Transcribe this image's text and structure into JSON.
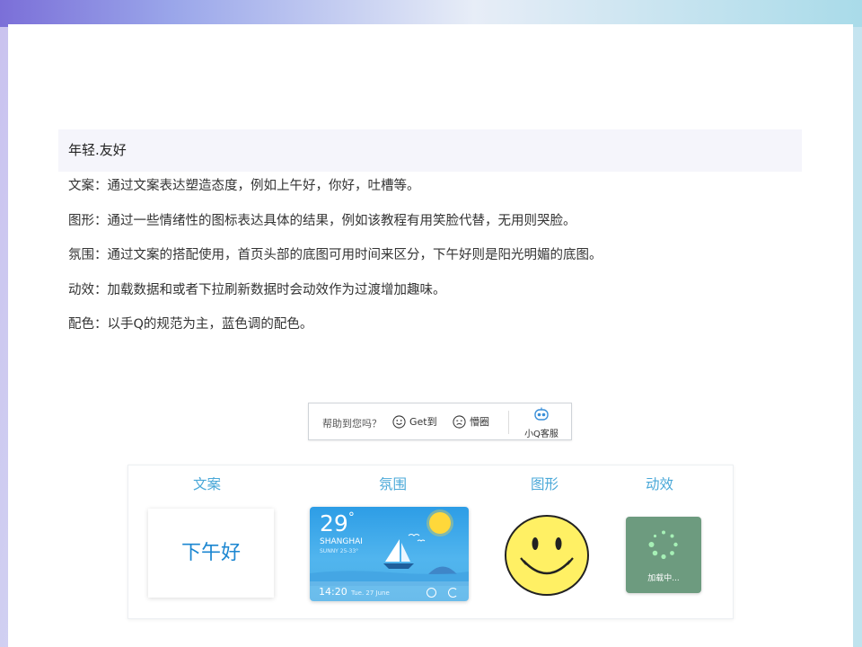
{
  "section": {
    "title": "年轻.友好",
    "items": [
      "文案：通过文案表达塑造态度，例如上午好，你好，吐槽等。",
      "图形：通过一些情绪性的图标表达具体的结果，例如该教程有用笑脸代替，无用则哭脸。",
      "氛围：通过文案的搭配使用，首页头部的底图可用时间来区分，下午好则是阳光明媚的底图。",
      "动效：加载数据和或者下拉刷新数据时会动效作为过渡增加趣味。",
      "配色：以手Q的规范为主，蓝色调的配色。"
    ]
  },
  "help_bar": {
    "question": "帮助到您吗？",
    "got_it": "Get到",
    "confused": "懵圈",
    "service": "小Q客服"
  },
  "demo": {
    "labels": {
      "copy": "文案",
      "mood": "氛围",
      "graphic": "图形",
      "motion": "动效"
    },
    "copy_text": "下午好",
    "weather": {
      "temp": "29",
      "deg": "°",
      "city": "SHANGHAI",
      "cond": "SUNNY  25-33°",
      "time": "14:20",
      "date": "Tue. 27 June"
    },
    "loading_text": "加载中..."
  },
  "colors": {
    "accent_blue": "#4aa8d8",
    "copy_blue": "#1b86d1",
    "loading_green": "#6d9b7f",
    "smiley_yellow": "#fff064"
  },
  "icons": [
    "smile-icon",
    "confused-icon",
    "robot-icon",
    "sun-icon",
    "sailboat-icon",
    "clock-icon",
    "refresh-icon",
    "spinner-icon"
  ]
}
